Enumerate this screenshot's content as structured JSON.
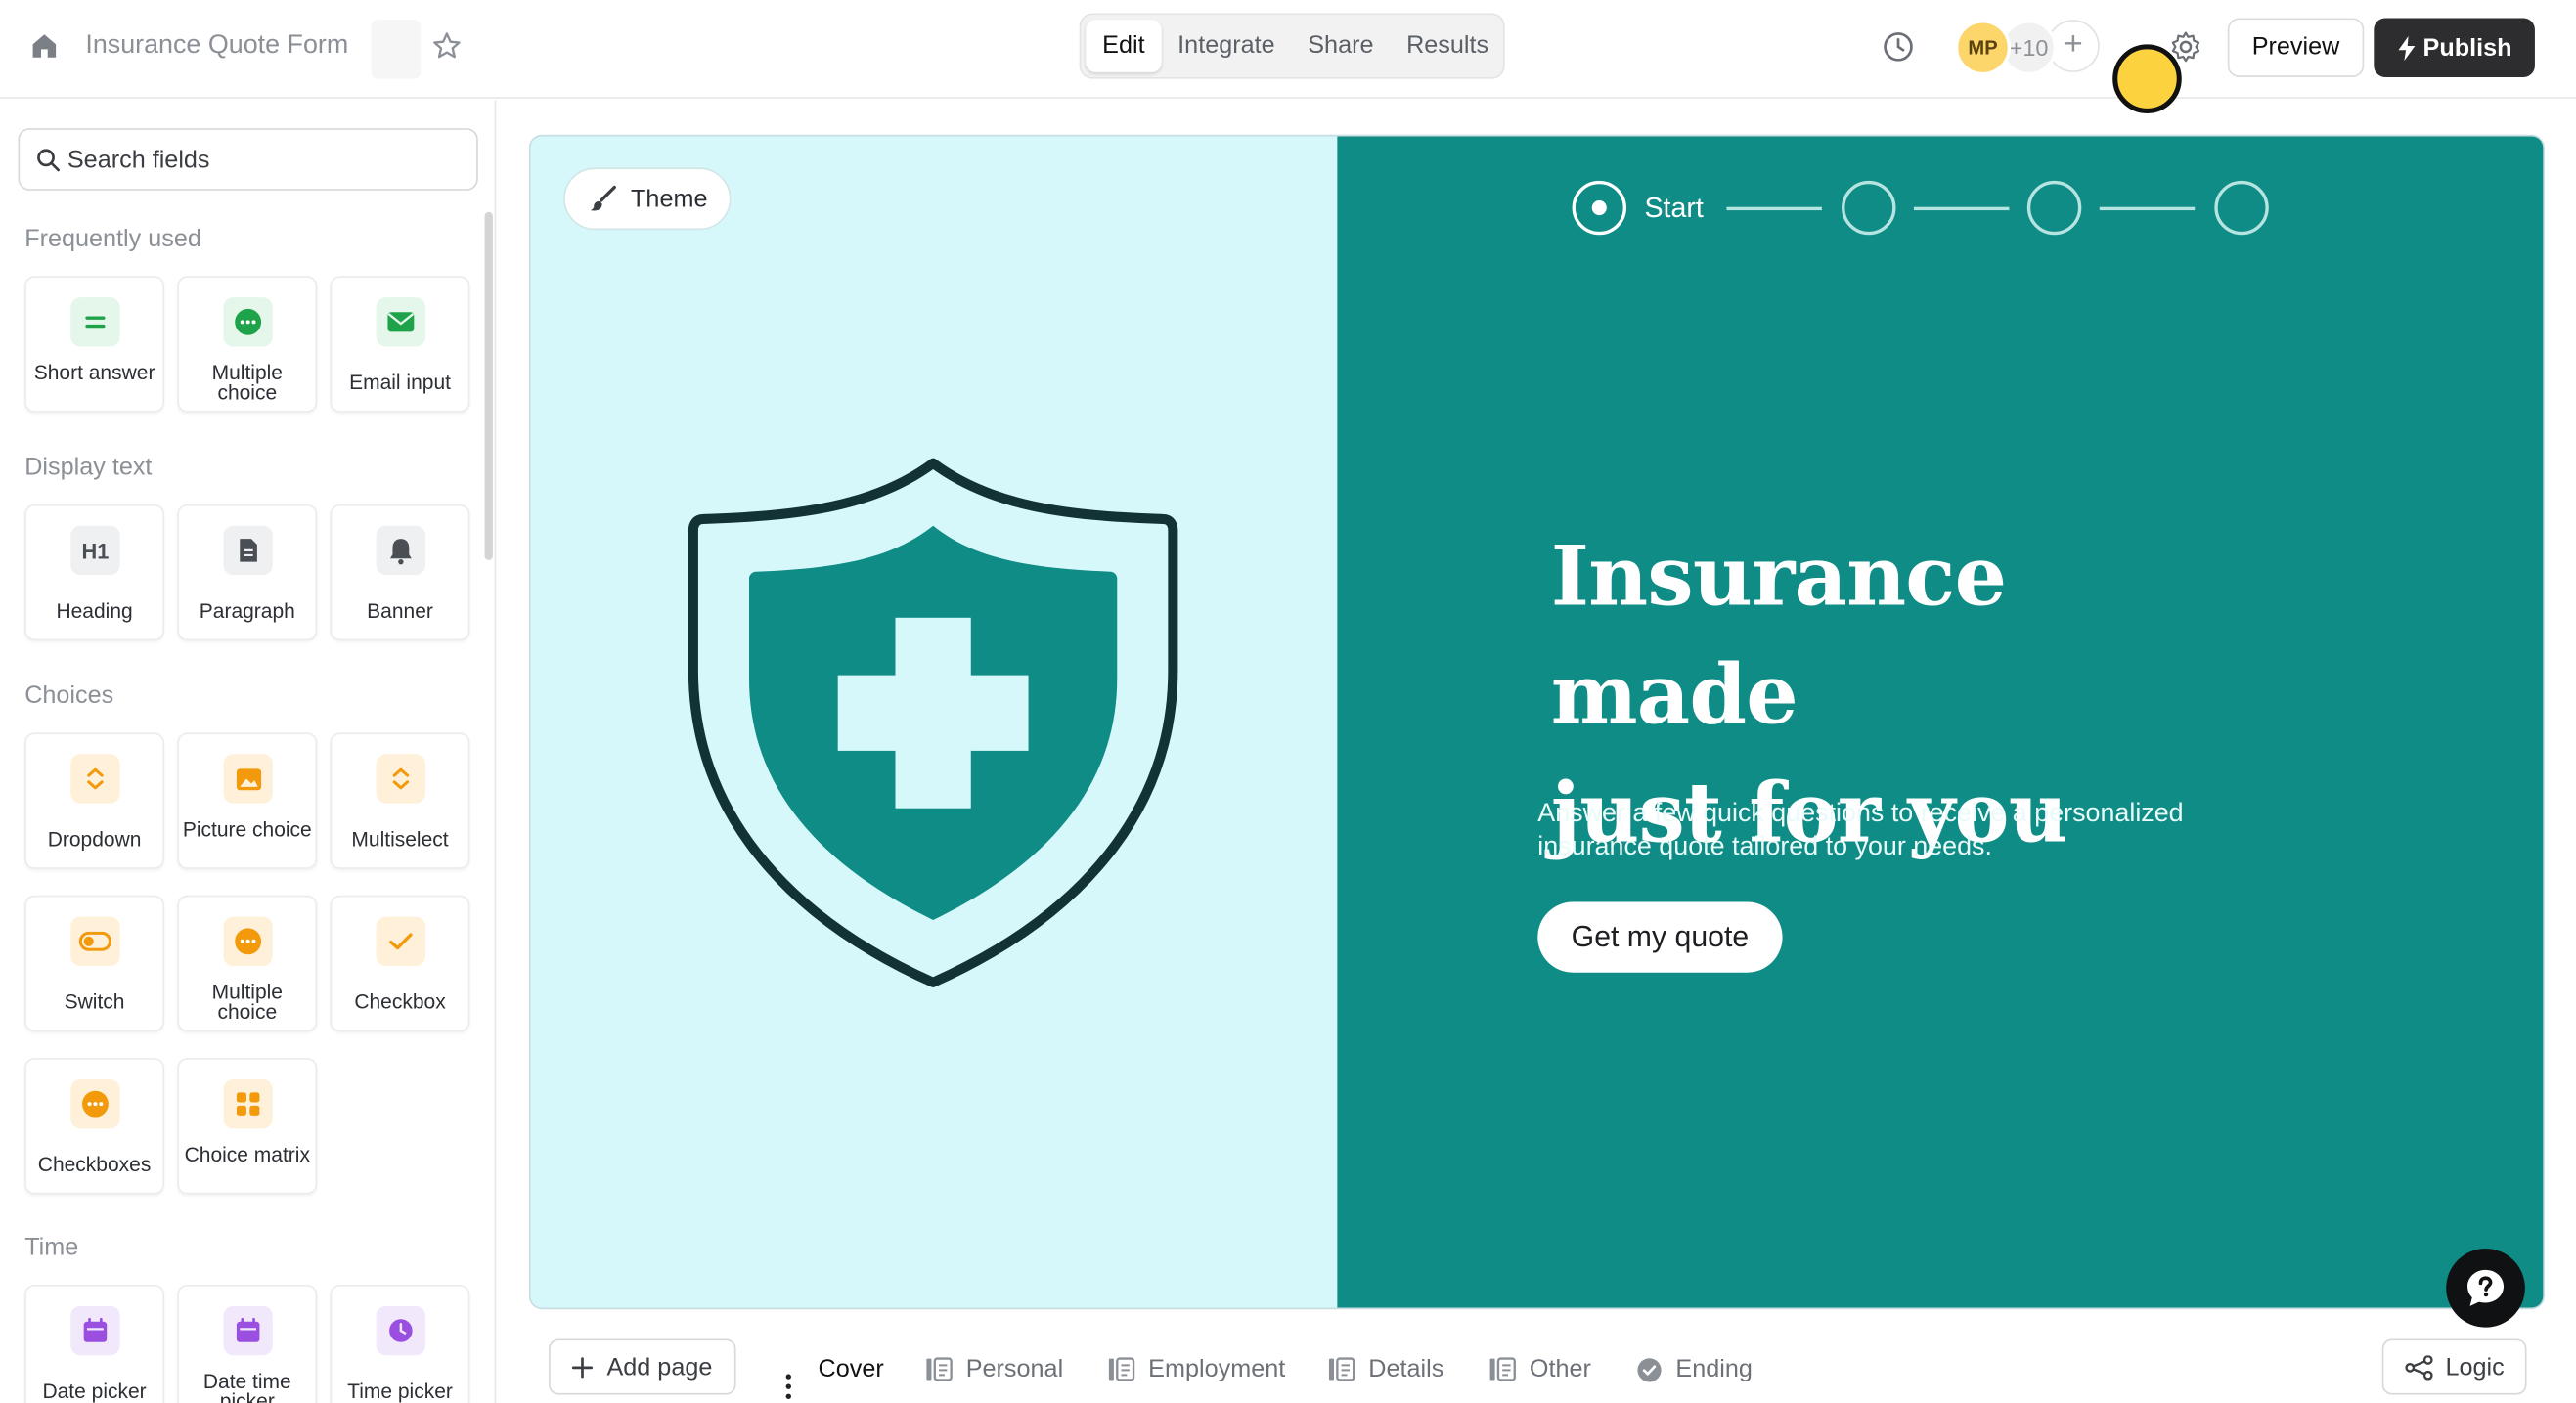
{
  "header": {
    "form_title": "Insurance Quote Form",
    "tabs": [
      {
        "label": "Edit",
        "active": true
      },
      {
        "label": "Integrate",
        "active": false
      },
      {
        "label": "Share",
        "active": false
      },
      {
        "label": "Results",
        "active": false
      }
    ],
    "avatar_initials": "MP",
    "avatar_more": "+10",
    "avatar_add": "+",
    "preview_label": "Preview",
    "publish_label": "Publish"
  },
  "sidebar": {
    "search_placeholder": "Search fields",
    "sections": {
      "frequently_used": "Frequently used",
      "display_text": "Display text",
      "choices": "Choices",
      "time": "Time"
    },
    "frequently_used": [
      {
        "label": "Short answer",
        "icon": "short-answer-icon"
      },
      {
        "label": "Multiple choice",
        "icon": "multiple-choice-icon"
      },
      {
        "label": "Email input",
        "icon": "email-icon"
      }
    ],
    "display_text": [
      {
        "label": "Heading",
        "icon": "h1-icon",
        "glyph": "H1"
      },
      {
        "label": "Paragraph",
        "icon": "paragraph-icon"
      },
      {
        "label": "Banner",
        "icon": "bell-icon"
      }
    ],
    "choices": [
      {
        "label": "Dropdown",
        "icon": "dropdown-icon"
      },
      {
        "label": "Picture choice",
        "icon": "picture-icon"
      },
      {
        "label": "Multiselect",
        "icon": "multiselect-icon"
      },
      {
        "label": "Switch",
        "icon": "switch-icon"
      },
      {
        "label": "Multiple choice",
        "icon": "multiple-choice-icon"
      },
      {
        "label": "Checkbox",
        "icon": "checkbox-icon"
      },
      {
        "label": "Checkboxes",
        "icon": "checkboxes-icon"
      },
      {
        "label": "Choice matrix",
        "icon": "matrix-icon"
      }
    ],
    "time": [
      {
        "label": "Date picker",
        "icon": "calendar-icon"
      },
      {
        "label": "Date time picker",
        "icon": "calendar-icon"
      },
      {
        "label": "Time picker",
        "icon": "clock-icon"
      }
    ]
  },
  "canvas": {
    "theme_label": "Theme",
    "step_label": "Start",
    "title_line1": "Insurance made",
    "title_line2": "just for you",
    "subtitle": "Answer a few quick questions to receive a personalized insurance quote tailored to your needs.",
    "cta_label": "Get my quote",
    "colors": {
      "left_bg": "#d7f8fb",
      "right_bg": "#0f8c86",
      "shield": "#0f8c86"
    }
  },
  "bottombar": {
    "add_page_label": "Add page",
    "pages": [
      {
        "label": "Cover",
        "active": true,
        "icon": ""
      },
      {
        "label": "Personal",
        "active": false,
        "icon": "page-icon"
      },
      {
        "label": "Employment",
        "active": false,
        "icon": "page-icon"
      },
      {
        "label": "Details",
        "active": false,
        "icon": "page-icon"
      },
      {
        "label": "Other",
        "active": false,
        "icon": "page-icon"
      },
      {
        "label": "Ending",
        "active": false,
        "icon": "check-circle-icon"
      }
    ],
    "logic_label": "Logic"
  }
}
